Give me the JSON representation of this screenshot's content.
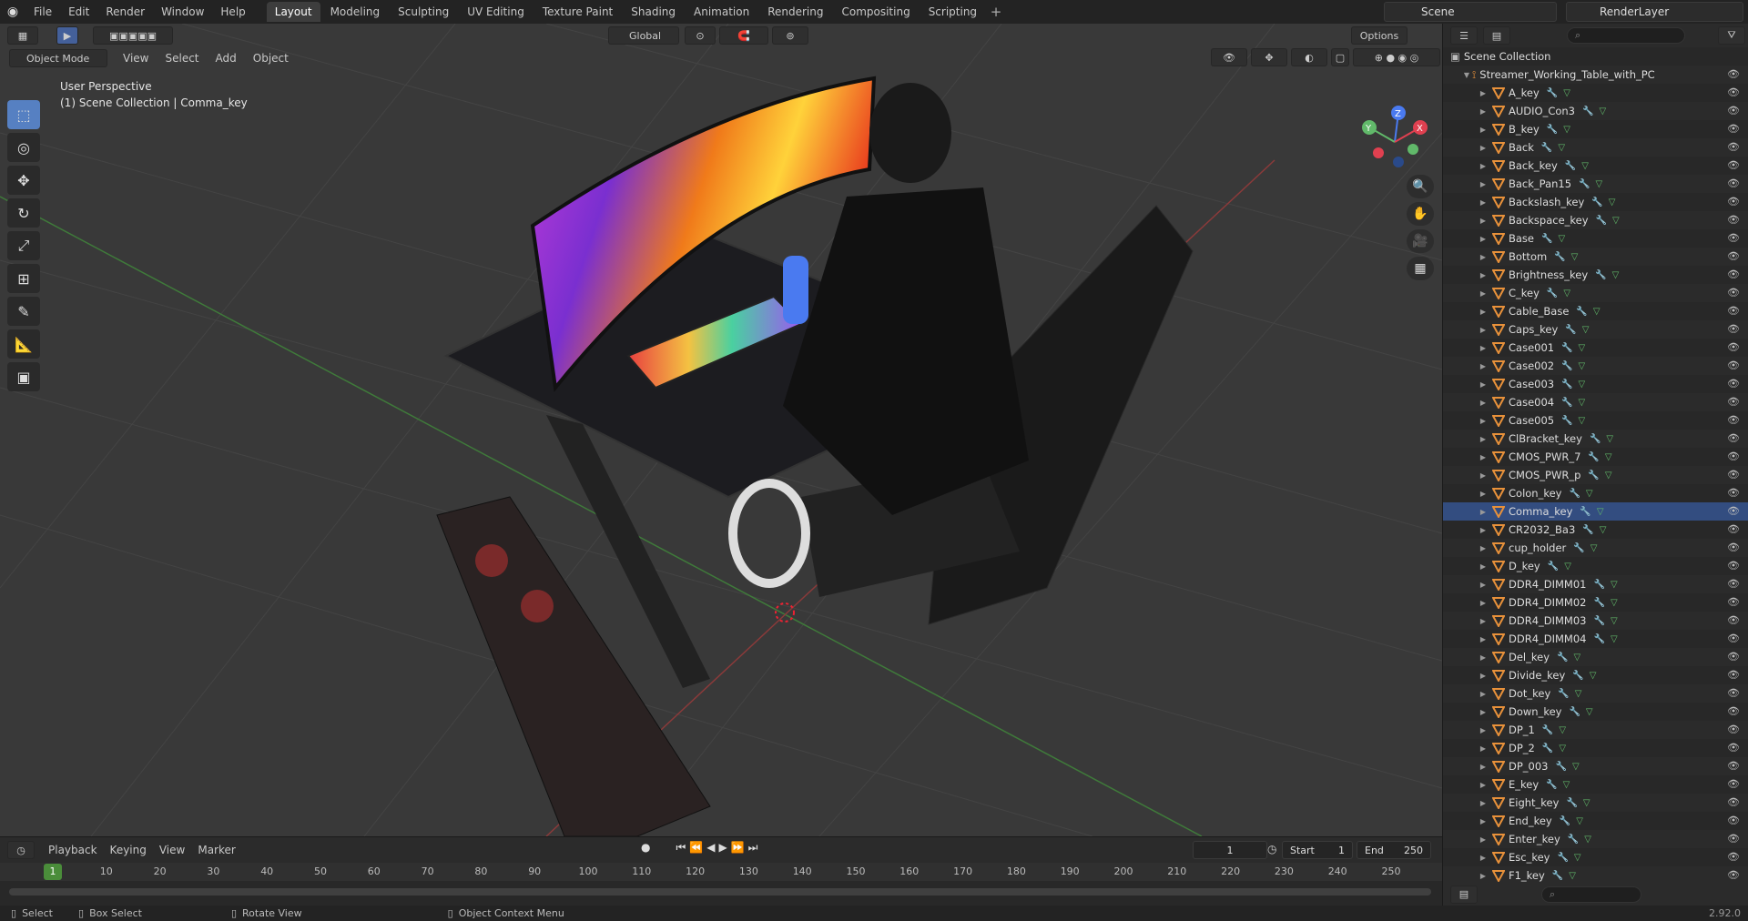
{
  "topbar": {
    "menu": [
      "File",
      "Edit",
      "Render",
      "Window",
      "Help"
    ],
    "tabs": [
      {
        "label": "Layout",
        "active": true
      },
      {
        "label": "Modeling"
      },
      {
        "label": "Sculpting"
      },
      {
        "label": "UV Editing"
      },
      {
        "label": "Texture Paint"
      },
      {
        "label": "Shading"
      },
      {
        "label": "Animation"
      },
      {
        "label": "Rendering"
      },
      {
        "label": "Compositing"
      },
      {
        "label": "Scripting"
      }
    ],
    "scene": "Scene",
    "render_layer": "RenderLayer"
  },
  "viewport": {
    "mode": "Object Mode",
    "menu": [
      "View",
      "Select",
      "Add",
      "Object"
    ],
    "orientation": "Global",
    "options": "Options",
    "perspective": "User Perspective",
    "context": "(1) Scene Collection | Comma_key",
    "gizmo": {
      "z": "Z",
      "y": "Y",
      "x": "X"
    }
  },
  "timeline": {
    "menu": [
      "Playback",
      "Keying",
      "View",
      "Marker"
    ],
    "current_frame": "1",
    "start_label": "Start",
    "start": "1",
    "end_label": "End",
    "end": "250",
    "ruler": [
      "1",
      "10",
      "20",
      "30",
      "40",
      "50",
      "60",
      "70",
      "80",
      "90",
      "100",
      "110",
      "120",
      "130",
      "140",
      "150",
      "160",
      "170",
      "180",
      "190",
      "200",
      "210",
      "220",
      "230",
      "240",
      "250"
    ]
  },
  "outliner": {
    "scene_collection": "Scene Collection",
    "root": "Streamer_Working_Table_with_PC",
    "selected": "Comma_key",
    "items": [
      "A_key",
      "AUDIO_Con3",
      "B_key",
      "Back",
      "Back_key",
      "Back_Pan15",
      "Backslash_key",
      "Backspace_key",
      "Base",
      "Bottom",
      "Brightness_key",
      "C_key",
      "Cable_Base",
      "Caps_key",
      "Case001",
      "Case002",
      "Case003",
      "Case004",
      "Case005",
      "ClBracket_key",
      "CMOS_PWR_7",
      "CMOS_PWR_p",
      "Colon_key",
      "Comma_key",
      "CR2032_Ba3",
      "cup_holder",
      "D_key",
      "DDR4_DIMM01",
      "DDR4_DIMM02",
      "DDR4_DIMM03",
      "DDR4_DIMM04",
      "Del_key",
      "Divide_key",
      "Dot_key",
      "Down_key",
      "DP_1",
      "DP_2",
      "DP_003",
      "E_key",
      "Eight_key",
      "End_key",
      "Enter_key",
      "Esc_key",
      "F1_key"
    ]
  },
  "statusbar": {
    "select": "Select",
    "box_select": "Box Select",
    "rotate": "Rotate View",
    "context_menu": "Object Context Menu",
    "version": "2.92.0"
  },
  "colors": {
    "accent": "#5680c2",
    "selected_row": "#334d80",
    "frame_marker": "#4a8d3a",
    "object_icon": "#e8913a"
  }
}
